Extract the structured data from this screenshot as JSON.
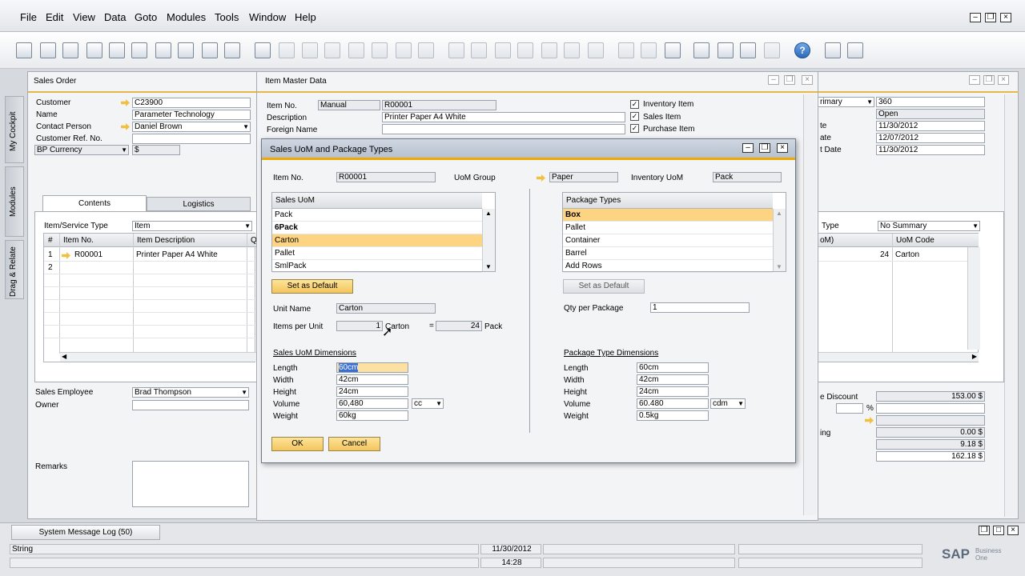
{
  "menu": [
    "File",
    "Edit",
    "View",
    "Data",
    "Goto",
    "Modules",
    "Tools",
    "Window",
    "Help"
  ],
  "sidebar": {
    "cockpit": "My Cockpit",
    "modules": "Modules",
    "drag_relate": "Drag & Relate"
  },
  "sales_order": {
    "title": "Sales Order",
    "fields": [
      {
        "label": "Customer",
        "value": "C23900"
      },
      {
        "label": "Name",
        "value": "Parameter Technology"
      },
      {
        "label": "Contact Person",
        "value": "Daniel Brown"
      },
      {
        "label": "Customer Ref. No.",
        "value": ""
      },
      {
        "label": "BP Currency",
        "value": "$"
      }
    ],
    "tabs": [
      "Contents",
      "Logistics"
    ],
    "item_type_label": "Item/Service Type",
    "item_type_value": "Item",
    "columns": [
      "#",
      "Item No.",
      "Item Description",
      "Q"
    ],
    "rows": [
      {
        "num": "1",
        "item_no": "R00001",
        "desc": "Printer Paper A4 White"
      },
      {
        "num": "2",
        "item_no": "",
        "desc": ""
      }
    ],
    "sales_employee_label": "Sales Employee",
    "sales_employee_value": "Brad Thompson",
    "owner_label": "Owner",
    "remarks_label": "Remarks",
    "right": {
      "primary_value": "rimary",
      "fields": [
        {
          "label": "",
          "value": "360"
        },
        {
          "label": "",
          "value": "Open"
        },
        {
          "label": "te",
          "value": "11/30/2012"
        },
        {
          "label": "ate",
          "value": "12/07/2012"
        },
        {
          "label": "t Date",
          "value": "11/30/2012"
        }
      ],
      "summary_label": "Type",
      "summary_value": "No Summary",
      "col_left": "oM)",
      "col_right": "UoM Code",
      "row_qty": "24",
      "row_code": "Carton",
      "discount_label": "e Discount",
      "discount_value": "153.00 $",
      "pct": "%",
      "rounding_label": "ing",
      "v1": "0.00 $",
      "v2": "9.18 $",
      "v3": "162.18 $"
    }
  },
  "item_master": {
    "title": "Item Master Data",
    "item_no_label": "Item No.",
    "item_no_mode": "Manual",
    "item_no_value": "R00001",
    "desc_label": "Description",
    "desc_value": "Printer Paper A4 White",
    "foreign_label": "Foreign Name",
    "checks": [
      "Inventory Item",
      "Sales Item",
      "Purchase Item"
    ]
  },
  "dialog": {
    "title": "Sales UoM and Package Types",
    "item_no_label": "Item No.",
    "item_no_value": "R00001",
    "uom_group_label": "UoM Group",
    "uom_group_value": "Paper",
    "inv_uom_label": "Inventory UoM",
    "inv_uom_value": "Pack",
    "sales_uom_header": "Sales UoM",
    "sales_uom": [
      "Pack",
      "6Pack",
      "Carton",
      "Pallet",
      "SmlPack"
    ],
    "sales_uom_selected": 2,
    "pkg_header": "Package Types",
    "pkg_types": [
      "Box",
      "Pallet",
      "Container",
      "Barrel",
      "Add Rows"
    ],
    "pkg_selected": 0,
    "set_default": "Set as Default",
    "unit_name_label": "Unit Name",
    "unit_name_value": "Carton",
    "items_per_unit_label": "Items per Unit",
    "items_per_unit_value": "1",
    "items_per_unit_unit": "Carton",
    "equals": "=",
    "items_per_unit_qty": "24",
    "items_per_unit_base": "Pack",
    "qty_per_pkg_label": "Qty per Package",
    "qty_per_pkg_value": "1",
    "sales_dim_header": "Sales UoM Dimensions",
    "pkg_dim_header": "Package Type Dimensions",
    "dim_labels": [
      "Length",
      "Width",
      "Height",
      "Volume",
      "Weight"
    ],
    "sales_dims": [
      "60cm",
      "42cm",
      "24cm",
      "60,480",
      "60kg"
    ],
    "sales_vol_unit": "cc",
    "pkg_dims": [
      "60cm",
      "42cm",
      "24cm",
      "60.480",
      "0.5kg"
    ],
    "pkg_vol_unit": "cdm",
    "ok": "OK",
    "cancel": "Cancel"
  },
  "status": {
    "log_tab": "System Message Log (50)",
    "message": "String",
    "date": "11/30/2012",
    "time": "14:28",
    "brand": "SAP",
    "brand_sub": "Business One"
  },
  "colors": {
    "highlight": "#fcd482",
    "accent": "#f0a800"
  }
}
